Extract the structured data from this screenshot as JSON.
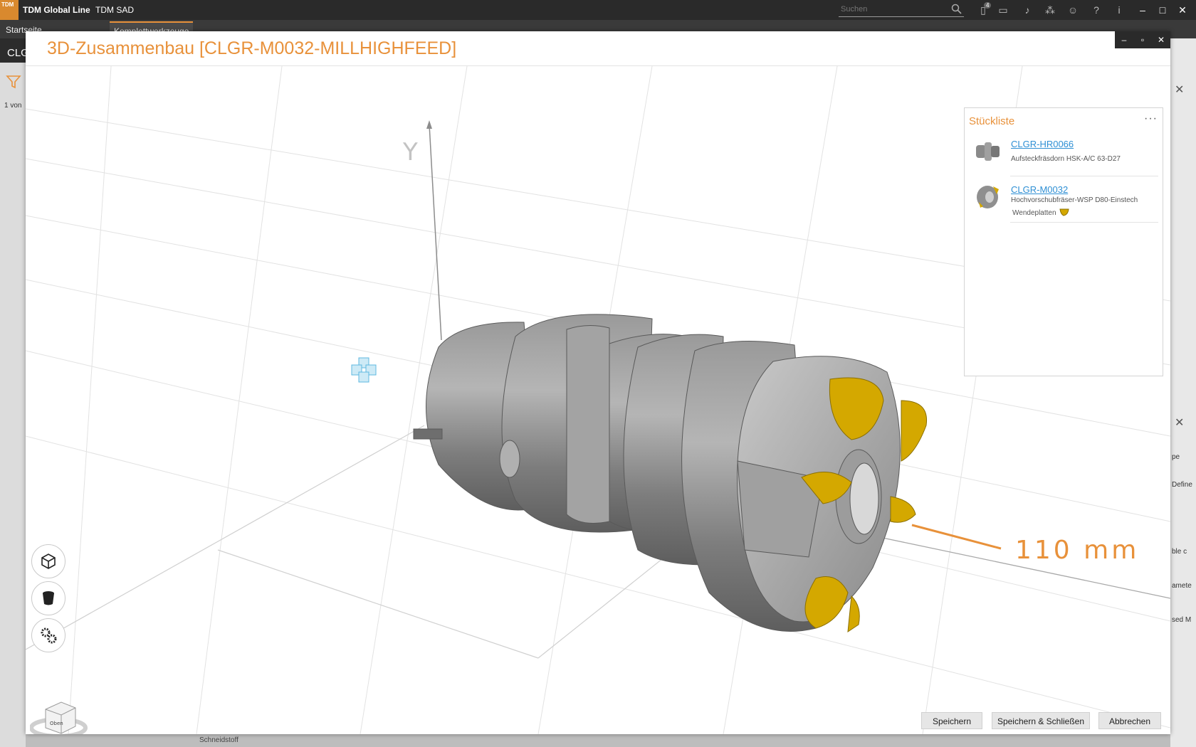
{
  "app": {
    "logo_text": "TDM",
    "product": "TDM Global Line",
    "module": "TDM SAD",
    "search_placeholder": "Suchen",
    "notification_count": "4"
  },
  "background": {
    "tabs": [
      "Startseite",
      "Komplettwerkzeuge"
    ],
    "left_field": "CLG",
    "page_counter": "1 von",
    "right_fragments": [
      "pe",
      "Define",
      "ble c",
      "amete",
      "sed M"
    ],
    "bottom_fragment": "Schneidstoff"
  },
  "modal": {
    "title": "3D-Zusammenbau [CLGR-M0032-MILLHIGHFEED]",
    "window_controls": [
      "–",
      "▫",
      "✕"
    ]
  },
  "viewport": {
    "axis_label_y": "Y",
    "dimension_label": "110 mm",
    "cube_face_label": "Oben",
    "accent_color": "#e8913a",
    "insert_color": "#d4a800"
  },
  "parts_list": {
    "title": "Stückliste",
    "more_icon": "···",
    "items": [
      {
        "code": "CLGR-HR0066",
        "description": "Aufsteckfräsdorn HSK-A/C 63-D27",
        "sub": ""
      },
      {
        "code": "CLGR-M0032",
        "description": "Hochvorschubfräser-WSP D80-Einstech",
        "sub": "Wendeplatten"
      }
    ]
  },
  "tools": [
    "wireframe-cube-icon",
    "cylinder-icon",
    "gears-icon"
  ],
  "buttons": {
    "save": "Speichern",
    "save_close": "Speichern & Schließen",
    "cancel": "Abbrechen"
  }
}
